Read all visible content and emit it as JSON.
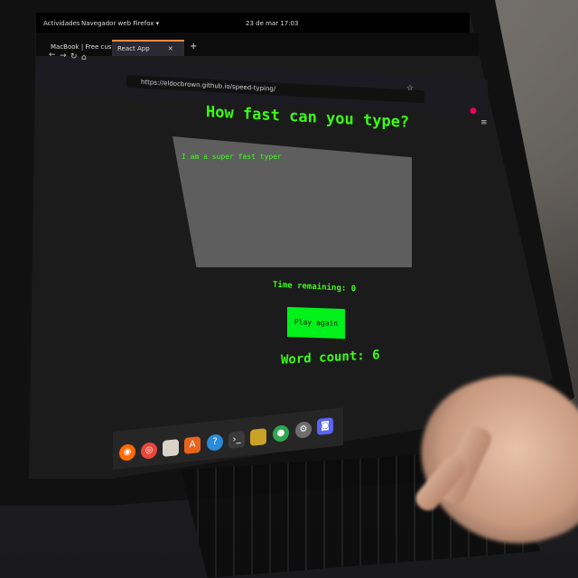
{
  "system_bar": {
    "activities": "Actividades",
    "app_menu": "Navegador web Firefox ▾",
    "clock": "23 de mar 17:03"
  },
  "browser": {
    "tabs": [
      {
        "label": "MacBook | Free custon",
        "active": false
      },
      {
        "label": "React App",
        "active": true
      }
    ],
    "new_tab": "+",
    "url": "https://eldocbrown.github.io/speed-typing/",
    "nav_icons": {
      "back": "back-arrow-icon",
      "forward": "forward-arrow-icon",
      "reload": "reload-icon",
      "home": "home-icon"
    }
  },
  "app": {
    "title": "How fast can you type?",
    "textarea_value": "I am a super fast typer",
    "time_remaining": "Time remaining: 0",
    "button_label": "Play again",
    "word_count": "Word count: 6"
  },
  "dock_icons": [
    "firefox-icon",
    "chrome-icon",
    "files-icon",
    "software-center-icon",
    "help-icon",
    "terminal-icon",
    "archive-icon",
    "green-app-icon",
    "settings-icon",
    "discord-icon"
  ],
  "colors": {
    "accent_green": "#39ff14",
    "button_green": "#00f21a",
    "firefox_tab": "#ff8a3d"
  }
}
